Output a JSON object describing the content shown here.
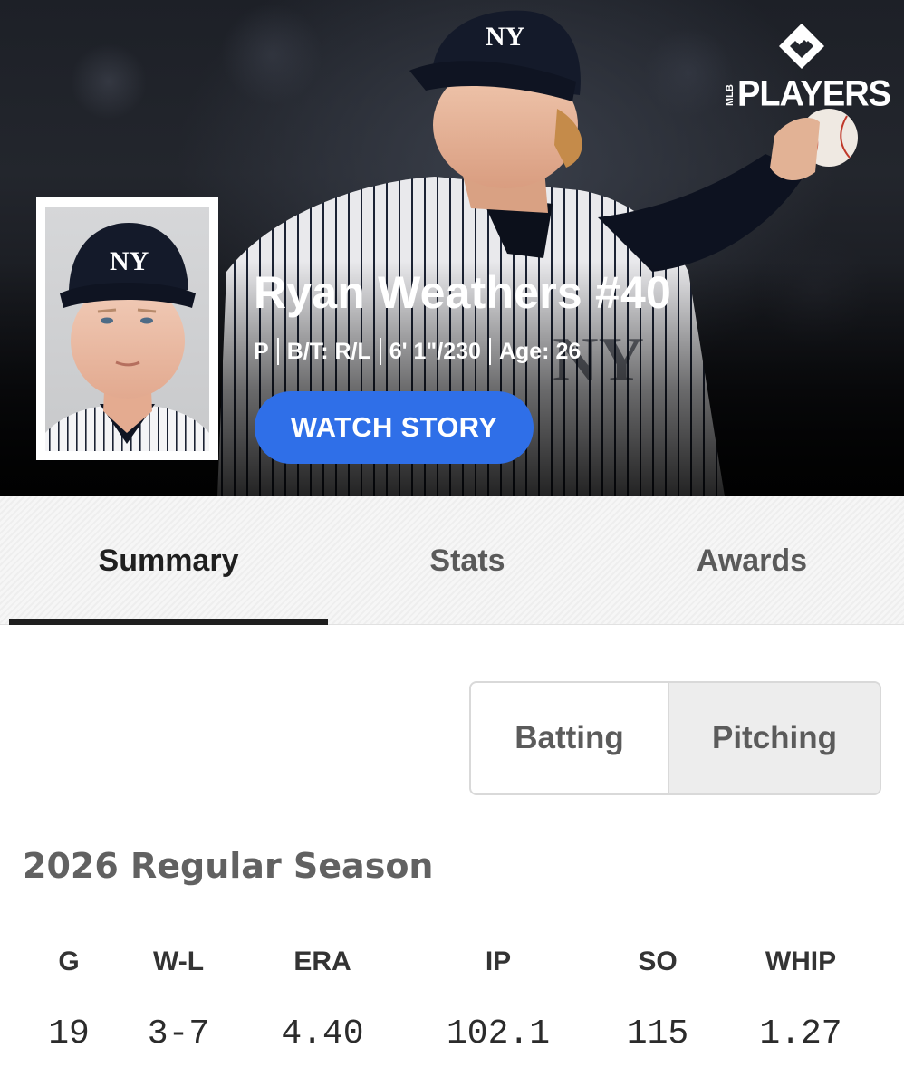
{
  "brand": {
    "logo_text": "PLAYERS",
    "logo_vertical_text": "MLB"
  },
  "player": {
    "name": "Ryan Weathers #40",
    "position": "P",
    "bats_throws": "B/T: R/L",
    "height_weight": "6' 1\"/230",
    "age": "Age: 26",
    "cap_logo": "NY"
  },
  "hero": {
    "watch_button": "WATCH STORY"
  },
  "tabs": [
    {
      "label": "Summary",
      "active": true
    },
    {
      "label": "Stats",
      "active": false
    },
    {
      "label": "Awards",
      "active": false
    }
  ],
  "toggle": {
    "options": [
      {
        "label": "Batting",
        "selected": false
      },
      {
        "label": "Pitching",
        "selected": true
      }
    ]
  },
  "season": {
    "title": "2026 Regular Season",
    "columns": [
      "G",
      "W-L",
      "ERA",
      "IP",
      "SO",
      "WHIP"
    ],
    "values": [
      "19",
      "3-7",
      "4.40",
      "102.1",
      "115",
      "1.27"
    ]
  },
  "colors": {
    "accent_button": "#2f6fe8",
    "tab_underline": "#1f1f1f",
    "toggle_selected_bg": "#ededed"
  }
}
